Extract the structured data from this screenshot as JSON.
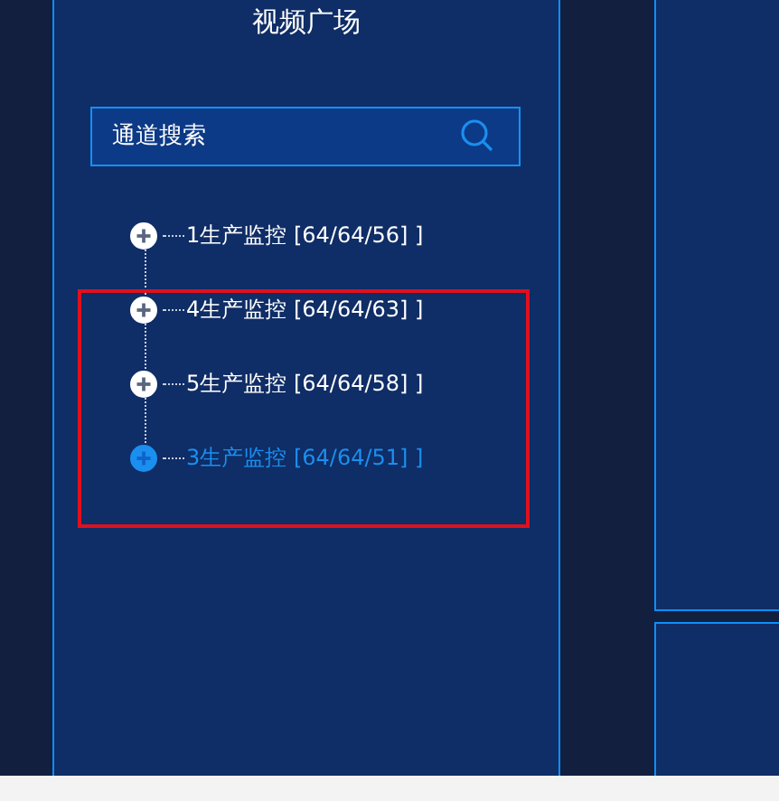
{
  "panel": {
    "title": "视频广场"
  },
  "search": {
    "placeholder": "通道搜索"
  },
  "tree": [
    {
      "label": "1生产监控 [64/64/56] ]",
      "selected": false,
      "expanded": false
    },
    {
      "label": "4生产监控 [64/64/63] ]",
      "selected": false,
      "expanded": false
    },
    {
      "label": "5生产监控 [64/64/58] ]",
      "selected": false,
      "expanded": false
    },
    {
      "label": "3生产监控 [64/64/51] ]",
      "selected": true,
      "expanded": false
    }
  ]
}
